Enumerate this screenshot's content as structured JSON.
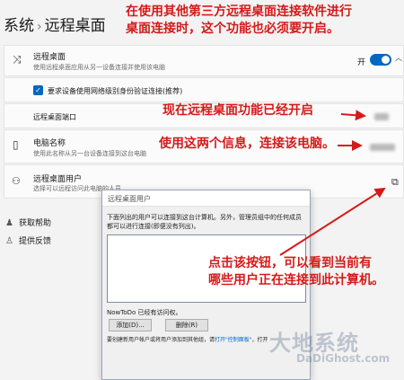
{
  "breadcrumb": {
    "parent": "系统",
    "separator": "›",
    "current": "远程桌面"
  },
  "remote_desktop": {
    "title": "远程桌面",
    "subtitle": "使用远程桌面应用从另一设备连接并使用该电脑",
    "toggle_label": "开",
    "toggle_state": "on"
  },
  "nla": {
    "label": "要求设备使用网络级别身份验证连接(推荐)",
    "checked": true
  },
  "port": {
    "title": "远程桌面端口"
  },
  "pc_name": {
    "title": "电脑名称",
    "subtitle": "使用此名称从另一台设备连接到这台电脑"
  },
  "users": {
    "title": "远程桌面用户",
    "subtitle": "选择可以远程访问此电脑的人员"
  },
  "links": {
    "help": "获取帮助",
    "feedback": "提供反馈"
  },
  "dialog": {
    "title": "远程桌面用户",
    "description": "下面列出的用户可以连接到这台计算机。另外，管理员组中的任何成员都可以进行连接(即便没有列出)。",
    "access_text": "NowToDo 已经有访问权。",
    "add_button": "添加(D)...",
    "remove_button": "删除(R)",
    "bottom_text": "要创建新用户帐户或将用户添加到其他组，请",
    "bottom_link": "打开\"控制面板\"",
    "bottom_suffix": "，打开"
  },
  "annotations": {
    "note1_line1": "在使用其他第三方远程桌面连接软件进行",
    "note1_line2": "桌面连接时，这个功能也必须要开启。",
    "note2": "现在远程桌面功能已经开启",
    "note3": "使用这两个信息，连接该电脑。",
    "note4_line1": "点击该按钮，可以看到当前有",
    "note4_line2": "哪些用户正在连接到此计算机。"
  },
  "watermark": {
    "main": "大地系统",
    "sub": "DaDiGhost.com"
  },
  "colors": {
    "accent": "#0067c0",
    "annotation": "#d51a1a"
  }
}
